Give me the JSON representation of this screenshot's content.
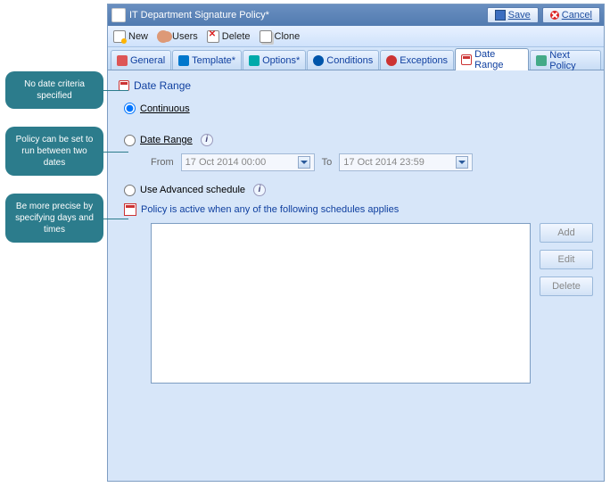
{
  "callouts": [
    "No date criteria specified",
    "Policy can be set to run between two dates",
    "Be more precise by specifying days and times"
  ],
  "title": "IT Department Signature Policy*",
  "title_buttons": {
    "save": "Save",
    "cancel": "Cancel"
  },
  "toolbar": {
    "new": "New",
    "users": "Users",
    "delete": "Delete",
    "clone": "Clone"
  },
  "tabs": {
    "general": "General",
    "template": "Template*",
    "options": "Options*",
    "conditions": "Conditions",
    "exceptions": "Exceptions",
    "daterange": "Date Range",
    "nextpolicy": "Next Policy"
  },
  "panel": {
    "heading": "Date Range",
    "opt_continuous": "Continuous",
    "opt_daterange": "Date Range",
    "from_label": "From",
    "to_label": "To",
    "from_value": "17 Oct 2014 00:00",
    "to_value": "17 Oct 2014 23:59",
    "opt_advanced": "Use Advanced schedule",
    "schedule_note": "Policy is active when any of the following schedules applies",
    "btn_add": "Add",
    "btn_edit": "Edit",
    "btn_delete": "Delete"
  }
}
